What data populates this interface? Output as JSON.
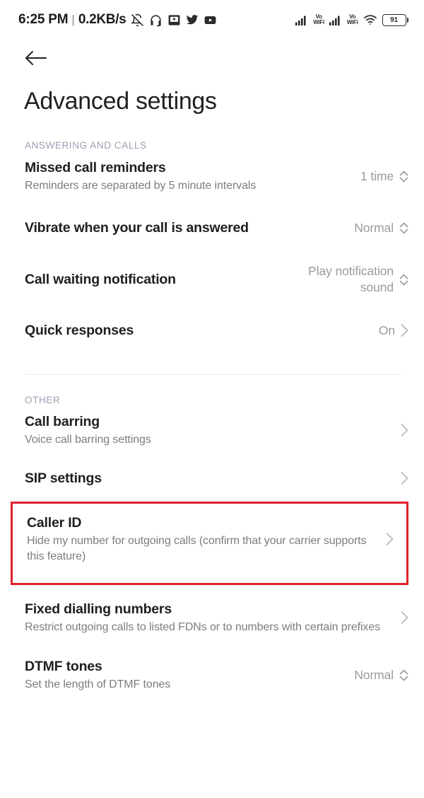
{
  "status_bar": {
    "time": "6:25 PM",
    "separator": "|",
    "network_speed": "0.2KB/s",
    "left_icons": [
      "bell-off-icon",
      "headset-icon",
      "screenshot-icon",
      "twitter-icon",
      "youtube-icon"
    ],
    "right_icons": [
      "signal-bars-icon",
      "volte-wifi-icon",
      "signal-bars-icon",
      "volte-wifi-icon",
      "wifi-icon"
    ],
    "volte_line1": "Vo",
    "volte_line2": "WiFi",
    "battery_percent": "91"
  },
  "header": {
    "back_icon": "arrow-left-icon",
    "title": "Advanced settings"
  },
  "sections": [
    {
      "label": "ANSWERING AND CALLS",
      "items": [
        {
          "title": "Missed call reminders",
          "subtitle": "Reminders are separated by 5 minute intervals",
          "value": "1 time",
          "control": "stepper"
        },
        {
          "title": "Vibrate when your call is answered",
          "subtitle": "",
          "value": "Normal",
          "control": "stepper"
        },
        {
          "title": "Call waiting notification",
          "subtitle": "",
          "value": "Play notification sound",
          "control": "stepper"
        },
        {
          "title": "Quick responses",
          "subtitle": "",
          "value": "On",
          "control": "chevron"
        }
      ]
    },
    {
      "label": "OTHER",
      "items": [
        {
          "title": "Call barring",
          "subtitle": "Voice call barring settings",
          "value": "",
          "control": "chevron"
        },
        {
          "title": "SIP settings",
          "subtitle": "",
          "value": "",
          "control": "chevron"
        },
        {
          "title": "Caller ID",
          "subtitle": "Hide my number for outgoing calls (confirm that your carrier supports this feature)",
          "value": "",
          "control": "chevron",
          "highlighted": true
        },
        {
          "title": "Fixed dialling numbers",
          "subtitle": "Restrict outgoing calls to listed FDNs or to numbers with certain prefixes",
          "value": "",
          "control": "chevron"
        },
        {
          "title": "DTMF tones",
          "subtitle": "Set the length of DTMF tones",
          "value": "Normal",
          "control": "stepper"
        }
      ]
    }
  ],
  "colors": {
    "highlight_red": "#e2202c",
    "title_text": "#202124",
    "secondary_text": "#7d7d7d",
    "section_label": "#9aa0b0"
  }
}
